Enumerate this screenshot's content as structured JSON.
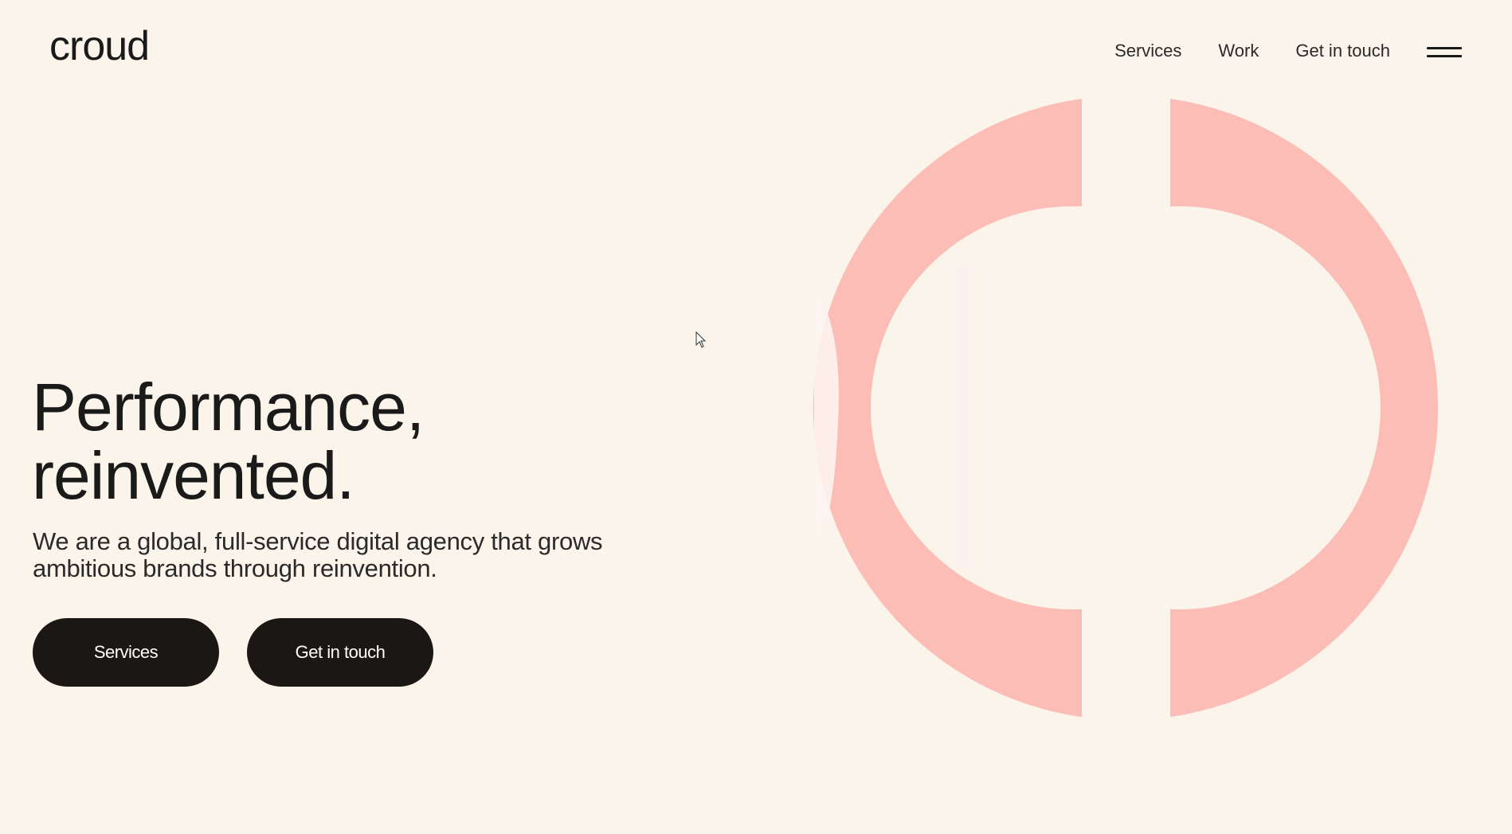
{
  "brand": {
    "logo_text": "croud",
    "accent_color": "#fdbdb7",
    "background_color": "#fbf4ea",
    "button_color": "#1a1715"
  },
  "nav": {
    "items": [
      {
        "label": "Services"
      },
      {
        "label": "Work"
      },
      {
        "label": "Get in touch"
      }
    ],
    "menu_icon": "hamburger-menu-icon"
  },
  "hero": {
    "title_line1": "Performance,",
    "title_line2": "reinvented.",
    "subtitle_line1": "We are a global, full-service digital agency that grows",
    "subtitle_line2": "ambitious brands through reinvention.",
    "buttons": {
      "services": "Services",
      "contact": "Get in touch"
    },
    "graphic": "c-ring-logo-graphic"
  }
}
